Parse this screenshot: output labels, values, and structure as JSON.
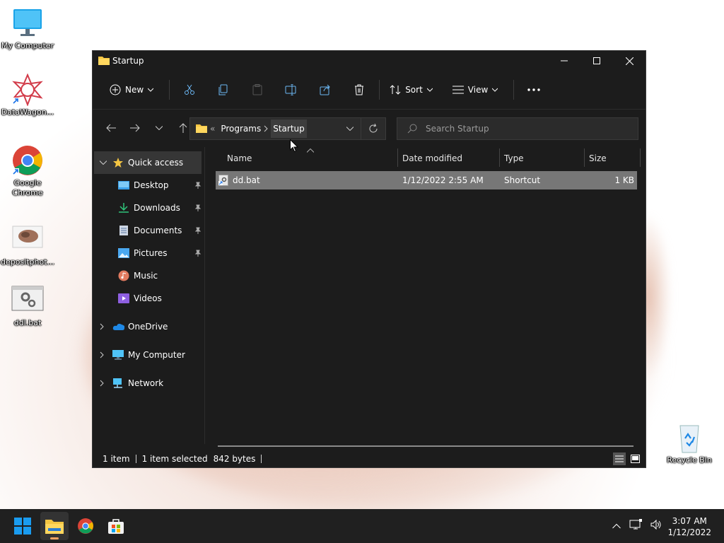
{
  "desktop": {
    "icons": [
      {
        "label": "My Computer"
      },
      {
        "label": "DataWagon..."
      },
      {
        "label": "Google Chrome"
      },
      {
        "label": "depositphot..."
      },
      {
        "label": "ddl.bat"
      },
      {
        "label": "Recycle Bin"
      }
    ]
  },
  "window": {
    "title": "Startup",
    "toolbar": {
      "new_label": "New",
      "sort_label": "Sort",
      "view_label": "View"
    },
    "address": {
      "prefix": "«",
      "crumbs": [
        "Programs",
        "Startup"
      ]
    },
    "search": {
      "placeholder": "Search Startup"
    },
    "sidebar": {
      "quick_access": "Quick access",
      "items": [
        {
          "label": "Desktop"
        },
        {
          "label": "Downloads"
        },
        {
          "label": "Documents"
        },
        {
          "label": "Pictures"
        },
        {
          "label": "Music"
        },
        {
          "label": "Videos"
        }
      ],
      "onedrive": "OneDrive",
      "my_computer": "My Computer",
      "network": "Network"
    },
    "columns": {
      "name": "Name",
      "date": "Date modified",
      "type": "Type",
      "size": "Size"
    },
    "files": [
      {
        "name": "dd.bat",
        "date": "1/12/2022 2:55 AM",
        "type": "Shortcut",
        "size": "1 KB"
      }
    ],
    "status": {
      "count": "1 item",
      "selected": "1 item selected",
      "bytes": "842 bytes"
    }
  },
  "taskbar": {
    "time": "3:07 AM",
    "date": "1/12/2022"
  },
  "colors": {
    "accent": "#0078d4",
    "folder": "#f4c542",
    "window_bg": "#1c1c1c",
    "selection": "#777777"
  }
}
